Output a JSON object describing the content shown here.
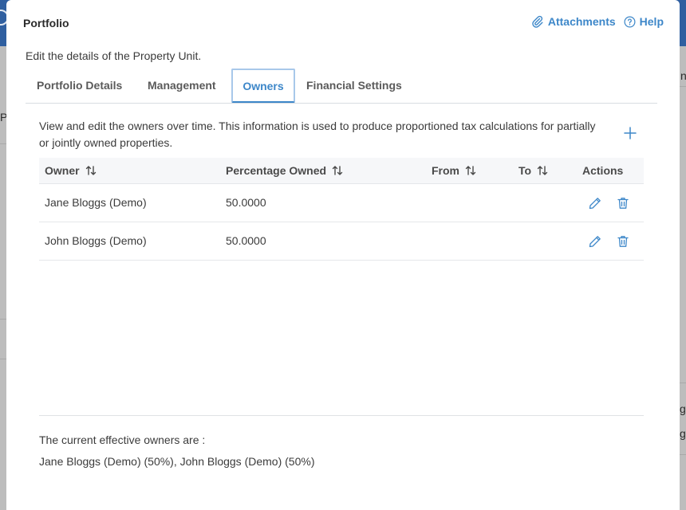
{
  "background": {
    "fragments": [
      "P",
      "n",
      "g",
      "g"
    ]
  },
  "modal": {
    "title": "Portfolio",
    "attachments_label": "Attachments",
    "help_label": "Help",
    "subtitle": "Edit the details of the Property Unit."
  },
  "tabs": [
    {
      "label": "Portfolio Details",
      "active": false
    },
    {
      "label": "Management",
      "active": false
    },
    {
      "label": "Owners",
      "active": true
    },
    {
      "label": "Financial Settings",
      "active": false
    }
  ],
  "owners": {
    "description": "View and edit the owners over time. This information is used to produce proportioned tax calculations for partially or jointly owned properties.",
    "columns": [
      "Owner",
      "Percentage Owned",
      "From",
      "To",
      "Actions"
    ],
    "rows": [
      {
        "owner": "Jane Bloggs (Demo)",
        "percentage": "50.0000",
        "from": "",
        "to": ""
      },
      {
        "owner": "John Bloggs (Demo)",
        "percentage": "50.0000",
        "from": "",
        "to": ""
      }
    ],
    "effective_label": "The current effective owners are :",
    "effective_value": "Jane Bloggs (Demo) (50%), John Bloggs (Demo) (50%)"
  },
  "colors": {
    "accent": "#3d87c9",
    "text": "#3b3b3b",
    "header_bg": "#f6f7f9"
  },
  "icons": {
    "attachments": "paperclip-icon",
    "help": "question-circle-icon",
    "add": "plus-icon",
    "sort": "sort-icon",
    "edit": "pencil-icon",
    "delete": "trash-icon"
  }
}
